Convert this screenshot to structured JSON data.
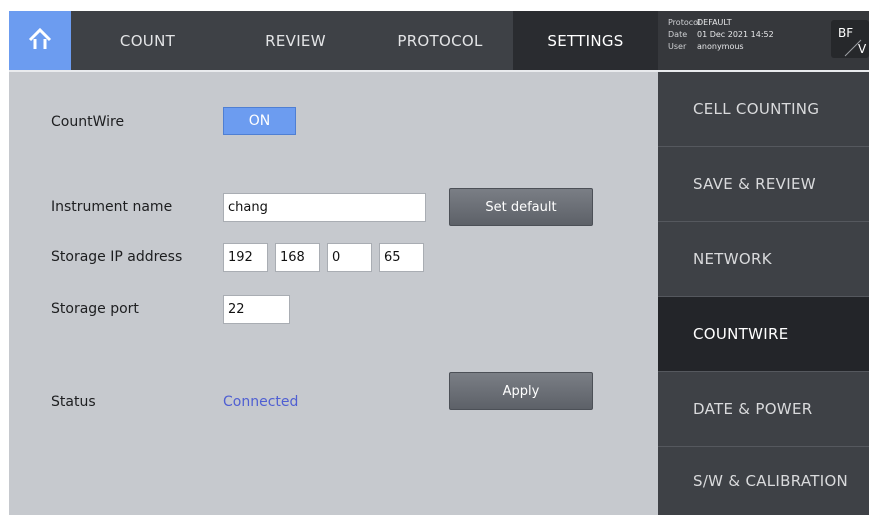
{
  "topbar": {
    "home_icon": "home-icon",
    "tabs": [
      "COUNT",
      "REVIEW",
      "PROTOCOL",
      "SETTINGS"
    ],
    "active_tab": "SETTINGS",
    "info": {
      "protocol_label": "Protocol",
      "protocol_value": "DEFAULT",
      "date_label": "Date",
      "date_value": "01 Dec 2021 14:52",
      "user_label": "User",
      "user_value": "anonymous"
    },
    "mode": {
      "top": "BF",
      "bottom": "V"
    }
  },
  "main": {
    "countwire_label": "CountWire",
    "countwire_toggle": "ON",
    "instrument_name_label": "Instrument name",
    "instrument_name_value": "chang",
    "set_default_button": "Set default",
    "storage_ip_label": "Storage IP address",
    "ip_octets": [
      "192",
      "168",
      "0",
      "65"
    ],
    "storage_port_label": "Storage port",
    "storage_port_value": "22",
    "status_label": "Status",
    "status_value": "Connected",
    "apply_button": "Apply"
  },
  "sidebar": {
    "items": [
      "CELL COUNTING",
      "SAVE & REVIEW",
      "NETWORK",
      "COUNTWIRE",
      "DATE & POWER",
      "S/W & CALIBRATION"
    ],
    "active_item": "COUNTWIRE"
  },
  "colors": {
    "accent": "#6c9cf0",
    "topbar": "#3e4146",
    "content_bg": "#c6c9ce",
    "status_connected": "#4f5fd2",
    "active_menu": "#232529"
  }
}
